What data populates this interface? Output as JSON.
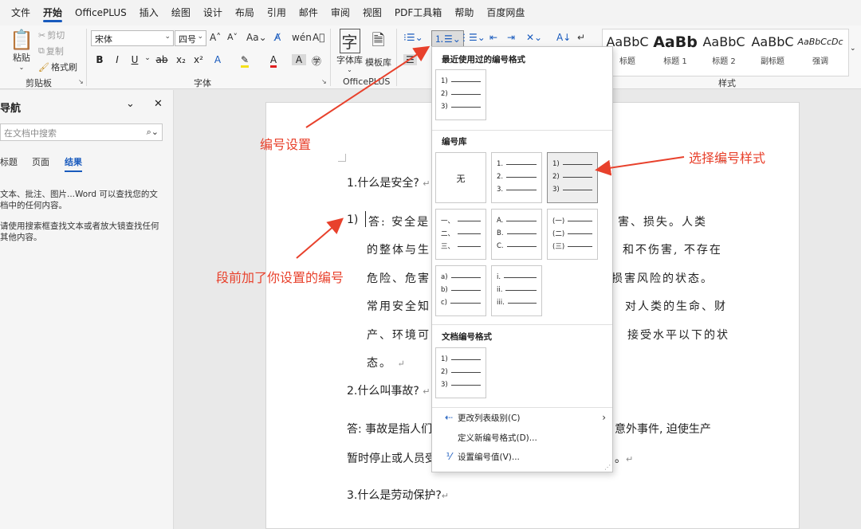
{
  "menu": [
    "文件",
    "开始",
    "OfficePLUS",
    "插入",
    "绘图",
    "设计",
    "布局",
    "引用",
    "邮件",
    "审阅",
    "视图",
    "PDF工具箱",
    "帮助",
    "百度网盘"
  ],
  "ribbon": {
    "clipboard": {
      "paste": "粘贴",
      "cut": "剪切",
      "copy": "复制",
      "format_painter": "格式刷",
      "label": "剪贴板"
    },
    "font": {
      "name": "宋体",
      "size": "四号",
      "label": "字体"
    },
    "officeplus": {
      "font_lib": "字体库",
      "template_lib": "模板库",
      "label": "OfficePLUS"
    },
    "styles": {
      "items": [
        {
          "sample": "AaBbC",
          "name": "标题"
        },
        {
          "sample": "AaBb",
          "name": "标题 1"
        },
        {
          "sample": "AaBbC",
          "name": "标题 2"
        },
        {
          "sample": "AaBbC",
          "name": "副标题"
        },
        {
          "sample": "AaBbCcDc",
          "name": "强调"
        }
      ],
      "label": "样式"
    }
  },
  "nav": {
    "title": "导航",
    "search_placeholder": "在文档中搜索",
    "tabs": [
      "标题",
      "页面",
      "结果"
    ],
    "text1": "文本、批注、图片...Word 可以查找您的文档中的任何内容。",
    "text2": "请使用搜索框查找文本或者放大镜查找任何其他内容。"
  },
  "doc": {
    "q1": "1.什么是安全?",
    "a1_num": "1)",
    "a1_lines": [
      "答: 安全是",
      "害、损失。人类",
      "的整体与生",
      "和不伤害, 不存在",
      "危险、危害",
      "损害风险的状态。",
      "常用安全知",
      "对人类的生命、财",
      "产、环境可",
      "接受水平以下的状",
      "态。"
    ],
    "q2": "2.什么叫事故?",
    "a2_line1_left": "答: 事故是指人们",
    "a2_line1_right": "意外事件, 迫使生产",
    "a2_line2_left": "暂时停止或人员受",
    "q3": "3.什么是劳动保护?",
    "return_mark": "↵"
  },
  "dropdown": {
    "recent_header": "最近使用过的编号格式",
    "library_header": "编号库",
    "doc_header": "文档编号格式",
    "none_label": "无",
    "tiles": [
      [
        "1)",
        "2)",
        "3)"
      ],
      [
        "1.",
        "2.",
        "3."
      ],
      [
        "1)",
        "2)",
        "3)"
      ],
      [
        "一、",
        "二、",
        "三、"
      ],
      [
        "A.",
        "B.",
        "C."
      ],
      [
        "(一)",
        "(二)",
        "(三)"
      ],
      [
        "a)",
        "b)",
        "c)"
      ],
      [
        "i.",
        "ii.",
        "iii."
      ],
      [
        "1)",
        "2)",
        "3)"
      ]
    ],
    "menu_items": [
      "更改列表级别(C)",
      "定义新编号格式(D)...",
      "设置编号值(V)..."
    ]
  },
  "annotations": {
    "numbering_setting": "编号设置",
    "choose_style": "选择编号样式",
    "paragraph_number": "段前加了你设置的编号"
  },
  "colors": {
    "accent": "#185abd",
    "annotation": "#e8412c"
  }
}
